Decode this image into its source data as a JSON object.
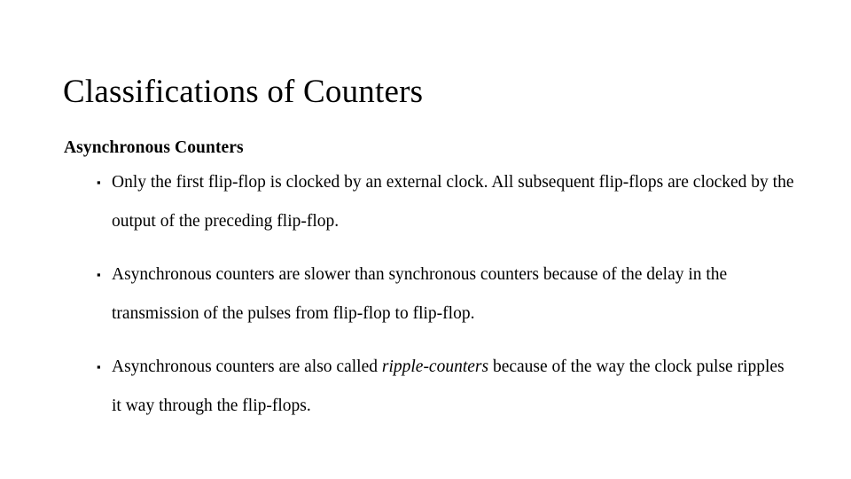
{
  "slide": {
    "title": "Classifications of Counters",
    "subtitle": "Asynchronous Counters",
    "bullet_marker": "▪",
    "bullets": [
      {
        "text_before": "Only the first flip-flop is clocked by an external clock. All subsequent flip-flops are clocked by the output of the preceding flip-flop.",
        "emphasis": "",
        "text_after": ""
      },
      {
        "text_before": "Asynchronous counters are slower than synchronous counters because of the delay in the transmission of the pulses from flip-flop to flip-flop.",
        "emphasis": "",
        "text_after": ""
      },
      {
        "text_before": "Asynchronous counters are also called ",
        "emphasis": "ripple-counters",
        "text_after": " because of the way the clock pulse ripples it way through the flip-flops."
      }
    ]
  }
}
